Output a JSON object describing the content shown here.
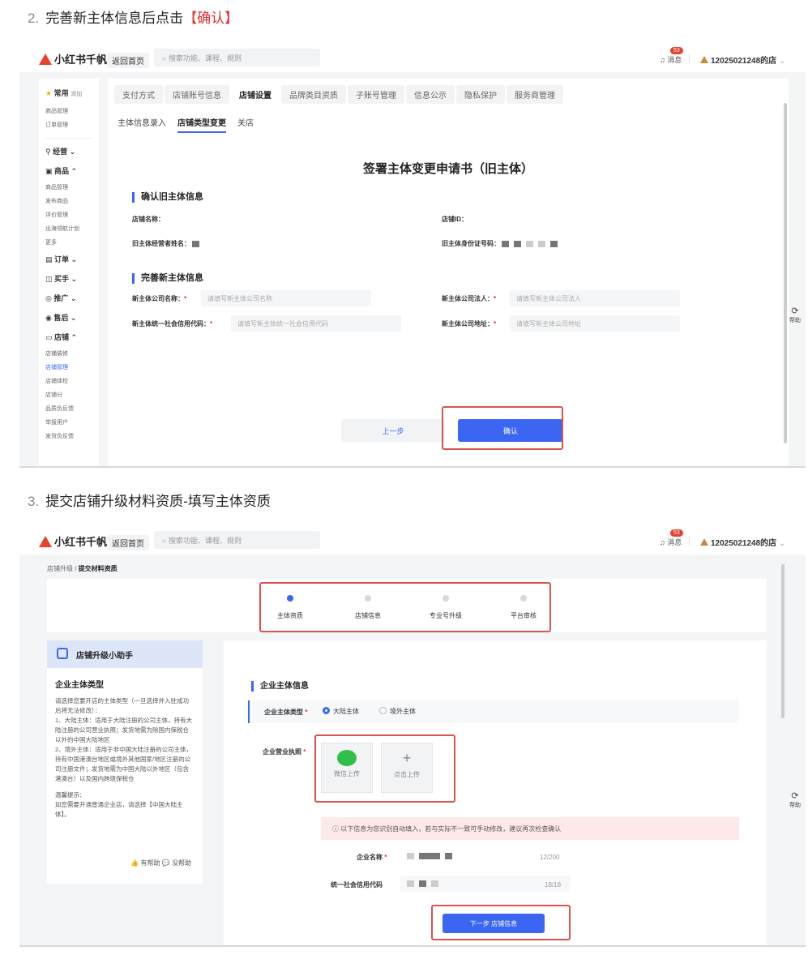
{
  "step2": {
    "num": "2.",
    "text": "完善新主体信息后点击",
    "highlight": "【确认】"
  },
  "step3": {
    "num": "3.",
    "text": "提交店铺升级材料资质-填写主体资质"
  },
  "app": {
    "logo": "小红书千帆",
    "back_home": "返回首页",
    "search_placeholder": "搜索功能、课程、规则",
    "msg": "消息",
    "msg_badge": "53",
    "user": "12025021248的店",
    "help": "帮助",
    "accent": "#3a66f2",
    "highlight_color": "#d9534f"
  },
  "sidebar": {
    "sections": [
      {
        "head": "常用",
        "extra": "添加",
        "items": [
          "商品管理",
          "订单管理"
        ]
      },
      {
        "head": "经营",
        "items": []
      },
      {
        "head": "商品",
        "items": [
          "商品管理",
          "发布商品",
          "评价管理",
          "出海领航计划",
          "更多"
        ]
      },
      {
        "head": "订单",
        "items": []
      },
      {
        "head": "买手",
        "items": []
      },
      {
        "head": "推广",
        "items": []
      },
      {
        "head": "售后",
        "items": []
      },
      {
        "head": "店铺",
        "items": [
          "店铺装修",
          "店铺管理",
          "店铺体检",
          "店铺分",
          "品质负反馈",
          "举报用户",
          "发货负反馈"
        ]
      }
    ],
    "active_item": "店铺管理"
  },
  "screen1": {
    "tabs": [
      "支付方式",
      "店铺账号信息",
      "店铺设置",
      "品牌类目资质",
      "子账号管理",
      "信息公示",
      "隐私保护",
      "服务商管理"
    ],
    "active_tab": "店铺设置",
    "subtabs": [
      "主体信息录入",
      "店铺类型变更",
      "关店"
    ],
    "active_subtab": "店铺类型变更",
    "form_title": "签署主体变更申请书（旧主体）",
    "confirm_old": {
      "title": "确认旧主体信息",
      "shop_name_label": "店铺名称：",
      "shop_id_label": "店铺ID：",
      "operator_label": "旧主体经营者姓名：",
      "id_label": "旧主体身份证号码："
    },
    "new_info": {
      "title": "完善新主体信息",
      "company_name_label": "新主体公司名称：",
      "company_name_ph": "请填写新主体公司名称",
      "legal_label": "新主体公司法人：",
      "legal_ph": "请填写新主体公司法人",
      "credit_label": "新主体统一社会信用代码：",
      "credit_ph": "请填写新主体统一社会信用代码",
      "address_label": "新主体公司地址：",
      "address_ph": "请填写新主体公司地址"
    },
    "prev_btn": "上一步",
    "ok_btn": "确认"
  },
  "screen2": {
    "breadcrumb_parent": "店铺升级",
    "breadcrumb_current": "提交材料资质",
    "steps": [
      "主体资质",
      "店铺信息",
      "专业号升级",
      "平台审核"
    ],
    "helper": {
      "title": "店铺升级小助手",
      "heading": "企业主体类型",
      "body": "请选择您要开店的主体类型（一旦选择并入驻成功后将无法修改）：\n1、大陆主体：适用于大陆注册的公司主体，持有大陆注册的公司营业执照；发货地需为除国内保税仓以外的中国大陆地区\n2、境外主体：适用于非中国大陆注册的公司主体，持有中国港澳台地区或境外其他国家/地区注册的公司注册文件；发货地需为中国大陆以外地区（包含港澳台）以及国内跨境保税仓",
      "tip": "温馨提示：\n如您需要开通普通企业店，请选择【中国大陆主体】。",
      "useful": "有帮助",
      "useless": "没帮助"
    },
    "section_title": "企业主体信息",
    "type_label": "企业主体类型",
    "type_options": [
      "大陆主体",
      "境外主体"
    ],
    "license_label": "企业营业执照",
    "upload_wechat": "微信上传",
    "upload_click": "点击上传",
    "notice": "以下信息为您识别自动填入，若与实际不一致可手动修改，建议再次检查确认",
    "company_label": "企业名称",
    "company_count": "12/200",
    "credit_label": "统一社会信用代码",
    "credit_count": "18/18",
    "next_btn": "下一步 店铺信息"
  }
}
